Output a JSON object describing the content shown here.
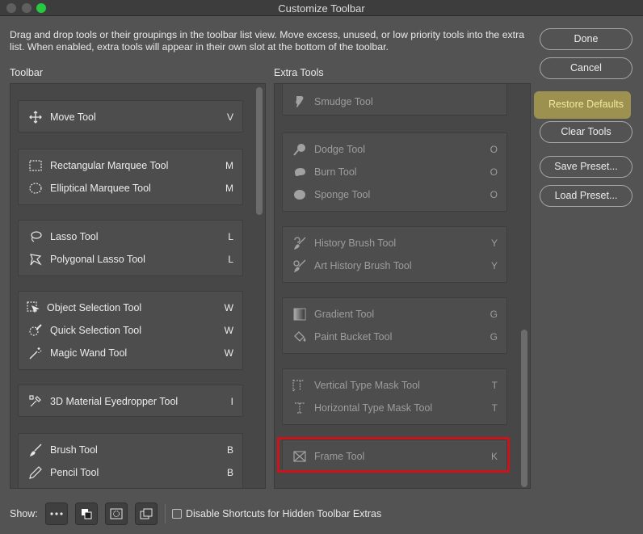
{
  "window": {
    "title": "Customize Toolbar"
  },
  "instructions": "Drag and drop tools or their groupings in the toolbar list view. Move excess, unused, or low priority tools into the extra list. When enabled, extra tools will appear in their own slot at the bottom of the toolbar.",
  "toolbar_panel": {
    "label": "Toolbar",
    "groups": [
      {
        "tools": [
          {
            "name": "Move Tool",
            "key": "V",
            "icon": "move-icon"
          }
        ]
      },
      {
        "tools": [
          {
            "name": "Rectangular Marquee Tool",
            "key": "M",
            "icon": "rect-marquee-icon"
          },
          {
            "name": "Elliptical Marquee Tool",
            "key": "M",
            "icon": "ellipse-marquee-icon"
          }
        ]
      },
      {
        "tools": [
          {
            "name": "Lasso Tool",
            "key": "L",
            "icon": "lasso-icon"
          },
          {
            "name": "Polygonal Lasso Tool",
            "key": "L",
            "icon": "polygonal-lasso-icon"
          }
        ]
      },
      {
        "tools": [
          {
            "name": "Object Selection Tool",
            "key": "W",
            "icon": "object-selection-icon"
          },
          {
            "name": "Quick Selection Tool",
            "key": "W",
            "icon": "quick-selection-icon"
          },
          {
            "name": "Magic Wand Tool",
            "key": "W",
            "icon": "magic-wand-icon"
          }
        ]
      },
      {
        "tools": [
          {
            "name": "3D Material Eyedropper Tool",
            "key": "I",
            "icon": "eyedropper-3d-icon"
          }
        ]
      },
      {
        "tools": [
          {
            "name": "Brush Tool",
            "key": "B",
            "icon": "brush-icon"
          },
          {
            "name": "Pencil Tool",
            "key": "B",
            "icon": "pencil-icon"
          }
        ]
      }
    ]
  },
  "extra_panel": {
    "label": "Extra Tools",
    "groups": [
      {
        "tools": [
          {
            "name": "Smudge Tool",
            "key": "",
            "icon": "smudge-icon"
          }
        ]
      },
      {
        "tools": [
          {
            "name": "Dodge Tool",
            "key": "O",
            "icon": "dodge-icon"
          },
          {
            "name": "Burn Tool",
            "key": "O",
            "icon": "burn-icon"
          },
          {
            "name": "Sponge Tool",
            "key": "O",
            "icon": "sponge-icon"
          }
        ]
      },
      {
        "tools": [
          {
            "name": "History Brush Tool",
            "key": "Y",
            "icon": "history-brush-icon"
          },
          {
            "name": "Art History Brush Tool",
            "key": "Y",
            "icon": "art-history-brush-icon"
          }
        ]
      },
      {
        "tools": [
          {
            "name": "Gradient Tool",
            "key": "G",
            "icon": "gradient-icon"
          },
          {
            "name": "Paint Bucket Tool",
            "key": "G",
            "icon": "paint-bucket-icon"
          }
        ]
      },
      {
        "tools": [
          {
            "name": "Vertical Type Mask Tool",
            "key": "T",
            "icon": "vertical-type-mask-icon"
          },
          {
            "name": "Horizontal Type Mask Tool",
            "key": "T",
            "icon": "horizontal-type-mask-icon"
          }
        ]
      },
      {
        "tools": [
          {
            "name": "Frame Tool",
            "key": "K",
            "icon": "frame-icon"
          }
        ]
      }
    ]
  },
  "buttons": {
    "done": "Done",
    "cancel": "Cancel",
    "restore_defaults": "Restore Defaults",
    "clear_tools": "Clear Tools",
    "save_preset": "Save Preset...",
    "load_preset": "Load Preset..."
  },
  "footer": {
    "show_label": "Show:",
    "show_icons": [
      "more-icon",
      "swatches-icon",
      "quick-mask-icon",
      "screen-mode-icon"
    ],
    "checkbox_label": "Disable Shortcuts for Hidden Toolbar Extras",
    "checkbox_checked": false
  },
  "colors": {
    "highlight": "#d8c54a",
    "annotation_red": "#c8141a"
  }
}
